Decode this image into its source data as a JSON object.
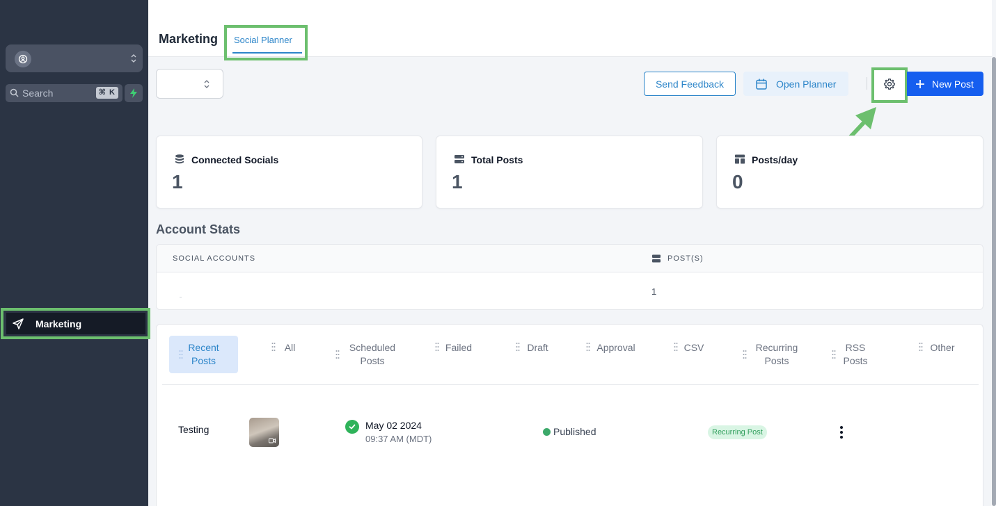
{
  "sidebar": {
    "search_placeholder": "Search",
    "search_shortcut": "⌘ K",
    "nav": {
      "marketing_label": "Marketing"
    }
  },
  "header": {
    "title": "Marketing",
    "tab_social_planner": "Social Planner"
  },
  "toolbar": {
    "send_feedback": "Send Feedback",
    "open_planner": "Open Planner",
    "new_post": "New Post"
  },
  "stats": [
    {
      "title": "Connected Socials",
      "value": "1",
      "icon": "database-icon"
    },
    {
      "title": "Total Posts",
      "value": "1",
      "icon": "server-icon"
    },
    {
      "title": "Posts/day",
      "value": "0",
      "icon": "layout-icon"
    }
  ],
  "account_stats": {
    "title": "Account Stats",
    "col_social": "SOCIAL ACCOUNTS",
    "col_posts": "POST(S)",
    "rows": [
      {
        "posts": "1"
      }
    ]
  },
  "post_tabs": [
    {
      "label_1": "Recent",
      "label_2": "Posts"
    },
    {
      "label_1": "All",
      "label_2": ""
    },
    {
      "label_1": "Scheduled",
      "label_2": "Posts"
    },
    {
      "label_1": "Failed",
      "label_2": ""
    },
    {
      "label_1": "Draft",
      "label_2": ""
    },
    {
      "label_1": "Approval",
      "label_2": ""
    },
    {
      "label_1": "CSV",
      "label_2": ""
    },
    {
      "label_1": "Recurring",
      "label_2": "Posts"
    },
    {
      "label_1": "RSS",
      "label_2": "Posts"
    },
    {
      "label_1": "Other",
      "label_2": ""
    }
  ],
  "posts": [
    {
      "title": "Testing",
      "date": "May 02 2024",
      "time": "09:37 AM (MDT)",
      "status": "Published",
      "badge": "Recurring Post"
    }
  ],
  "colors": {
    "accent": "#2c85c9",
    "primary_button": "#155eef",
    "sidebar_bg": "#2b3444",
    "annotation_green": "#6cbf6e",
    "published_green": "#2fb35a"
  }
}
